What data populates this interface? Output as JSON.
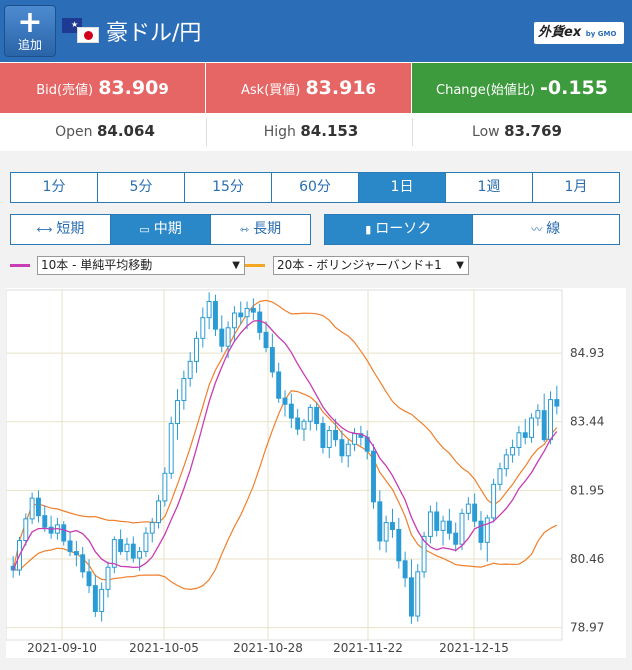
{
  "header": {
    "add_label": "追加",
    "pair": "豪ドル/円",
    "logo_main": "外貨ex",
    "logo_sub": "by GMO"
  },
  "quotes": {
    "bid_label": "Bid(売値)",
    "bid_main": "83.90",
    "bid_pip": "9",
    "ask_label": "Ask(買値)",
    "ask_main": "83.91",
    "ask_pip": "6",
    "change_label": "Change(始値比)",
    "change_value": "-0.155"
  },
  "ohl": {
    "open_label": "Open",
    "open_main": "84.06",
    "open_pip": "4",
    "high_label": "High",
    "high_main": "84.15",
    "high_pip": "3",
    "low_label": "Low",
    "low_main": "83.76",
    "low_pip": "9"
  },
  "timeframes": [
    "1分",
    "5分",
    "15分",
    "60分",
    "1日",
    "1週",
    "1月"
  ],
  "timeframe_selected": "1日",
  "terms": [
    "短期",
    "中期",
    "長期"
  ],
  "term_selected": "中期",
  "chart_types": [
    "ローソク",
    "線"
  ],
  "chart_type_selected": "ローソク",
  "indicators": {
    "ma": {
      "label": "10本 - 単純平均移動",
      "color": "#c83cb4"
    },
    "bb": {
      "label": "20本 - ボリンジャーバンド+1",
      "color": "#f5a623"
    }
  },
  "colors": {
    "candle": "#2a9bd4",
    "ma": "#c83cb4",
    "band": "#f07f2c"
  },
  "chart_data": {
    "type": "candlestick",
    "x_ticks": [
      "2021-09-10",
      "2021-10-05",
      "2021-10-28",
      "2021-11-22",
      "2021-12-15"
    ],
    "y_ticks": [
      84.93,
      83.44,
      81.95,
      80.46,
      78.97
    ],
    "ylim": [
      78.7,
      86.3
    ],
    "grid": true,
    "ohlc": [
      [
        80.3,
        80.52,
        80.05,
        80.22
      ],
      [
        80.22,
        80.94,
        80.1,
        80.86
      ],
      [
        80.86,
        81.45,
        80.75,
        81.33
      ],
      [
        81.33,
        81.9,
        81.22,
        81.78
      ],
      [
        81.78,
        81.95,
        81.25,
        81.4
      ],
      [
        81.4,
        81.62,
        81.05,
        81.15
      ],
      [
        81.15,
        81.4,
        80.9,
        81.02
      ],
      [
        81.02,
        81.35,
        80.88,
        81.2
      ],
      [
        81.2,
        81.28,
        80.75,
        80.85
      ],
      [
        80.85,
        81.05,
        80.52,
        80.62
      ],
      [
        80.62,
        80.85,
        80.3,
        80.55
      ],
      [
        80.55,
        80.72,
        80.05,
        80.18
      ],
      [
        80.18,
        80.45,
        79.72,
        79.88
      ],
      [
        79.88,
        80.12,
        79.2,
        79.32
      ],
      [
        79.32,
        79.95,
        79.1,
        79.8
      ],
      [
        79.8,
        80.4,
        79.62,
        80.28
      ],
      [
        80.28,
        80.95,
        80.15,
        80.88
      ],
      [
        80.88,
        81.1,
        80.55,
        80.62
      ],
      [
        80.62,
        80.92,
        80.42,
        80.78
      ],
      [
        80.78,
        80.95,
        80.38,
        80.48
      ],
      [
        80.48,
        80.72,
        80.2,
        80.62
      ],
      [
        80.62,
        81.15,
        80.5,
        81.02
      ],
      [
        81.02,
        81.35,
        80.82,
        81.25
      ],
      [
        81.25,
        81.85,
        81.12,
        81.72
      ],
      [
        81.72,
        82.45,
        81.6,
        82.32
      ],
      [
        82.32,
        83.55,
        82.2,
        83.4
      ],
      [
        83.4,
        84.15,
        83.05,
        83.9
      ],
      [
        83.9,
        84.55,
        83.7,
        84.38
      ],
      [
        84.38,
        84.95,
        84.2,
        84.75
      ],
      [
        84.75,
        85.4,
        84.5,
        85.25
      ],
      [
        85.25,
        85.92,
        85.05,
        85.7
      ],
      [
        85.7,
        86.25,
        85.45,
        86.05
      ],
      [
        86.05,
        86.2,
        85.3,
        85.45
      ],
      [
        85.45,
        85.75,
        84.95,
        85.08
      ],
      [
        85.08,
        85.62,
        84.82,
        85.48
      ],
      [
        85.48,
        85.95,
        85.2,
        85.8
      ],
      [
        85.8,
        86.05,
        85.55,
        85.72
      ],
      [
        85.72,
        86.05,
        85.45,
        85.9
      ],
      [
        85.9,
        86.12,
        85.65,
        85.82
      ],
      [
        85.82,
        86.0,
        85.22,
        85.38
      ],
      [
        85.38,
        85.62,
        84.95,
        85.05
      ],
      [
        85.05,
        85.35,
        84.4,
        84.52
      ],
      [
        84.52,
        84.72,
        83.85,
        83.95
      ],
      [
        83.95,
        84.12,
        83.55,
        83.82
      ],
      [
        83.82,
        84.05,
        83.3,
        83.52
      ],
      [
        83.52,
        83.72,
        83.15,
        83.28
      ],
      [
        83.28,
        83.5,
        83.02,
        83.45
      ],
      [
        83.45,
        83.82,
        83.25,
        83.75
      ],
      [
        83.75,
        83.85,
        83.25,
        83.4
      ],
      [
        83.4,
        83.55,
        82.75,
        82.88
      ],
      [
        82.88,
        83.35,
        82.65,
        83.25
      ],
      [
        83.25,
        83.5,
        82.9,
        83.05
      ],
      [
        83.05,
        83.25,
        82.55,
        82.7
      ],
      [
        82.7,
        83.05,
        82.45,
        82.95
      ],
      [
        82.95,
        83.3,
        82.8,
        83.18
      ],
      [
        83.18,
        83.35,
        82.92,
        83.1
      ],
      [
        83.1,
        83.25,
        82.62,
        82.8
      ],
      [
        82.8,
        82.95,
        81.55,
        81.7
      ],
      [
        81.7,
        81.95,
        80.65,
        80.85
      ],
      [
        80.85,
        81.4,
        80.6,
        81.25
      ],
      [
        81.25,
        81.55,
        80.92,
        81.1
      ],
      [
        81.1,
        81.35,
        80.25,
        80.42
      ],
      [
        80.42,
        80.62,
        79.85,
        80.05
      ],
      [
        80.05,
        80.45,
        79.05,
        79.22
      ],
      [
        79.22,
        80.35,
        79.1,
        80.18
      ],
      [
        80.18,
        81.05,
        80.05,
        80.95
      ],
      [
        80.95,
        81.62,
        80.8,
        81.48
      ],
      [
        81.48,
        81.7,
        80.95,
        81.08
      ],
      [
        81.08,
        81.4,
        80.75,
        81.28
      ],
      [
        81.28,
        81.55,
        80.88,
        81.02
      ],
      [
        81.02,
        81.25,
        80.62,
        80.78
      ],
      [
        80.78,
        81.55,
        80.65,
        81.45
      ],
      [
        81.45,
        81.8,
        81.3,
        81.65
      ],
      [
        81.65,
        81.88,
        81.15,
        81.28
      ],
      [
        81.28,
        81.5,
        80.65,
        80.82
      ],
      [
        80.82,
        81.42,
        80.4,
        81.35
      ],
      [
        81.35,
        82.2,
        81.25,
        82.08
      ],
      [
        82.08,
        82.55,
        81.95,
        82.42
      ],
      [
        82.42,
        82.85,
        82.25,
        82.72
      ],
      [
        82.72,
        83.05,
        82.55,
        82.88
      ],
      [
        82.88,
        83.35,
        82.7,
        83.2
      ],
      [
        83.2,
        83.5,
        82.95,
        83.1
      ],
      [
        83.1,
        83.62,
        82.98,
        83.52
      ],
      [
        83.52,
        83.82,
        83.35,
        83.68
      ],
      [
        83.68,
        84.05,
        83.0,
        83.05
      ],
      [
        83.05,
        84.1,
        82.95,
        83.92
      ],
      [
        83.92,
        84.22,
        83.6,
        83.78
      ]
    ]
  }
}
